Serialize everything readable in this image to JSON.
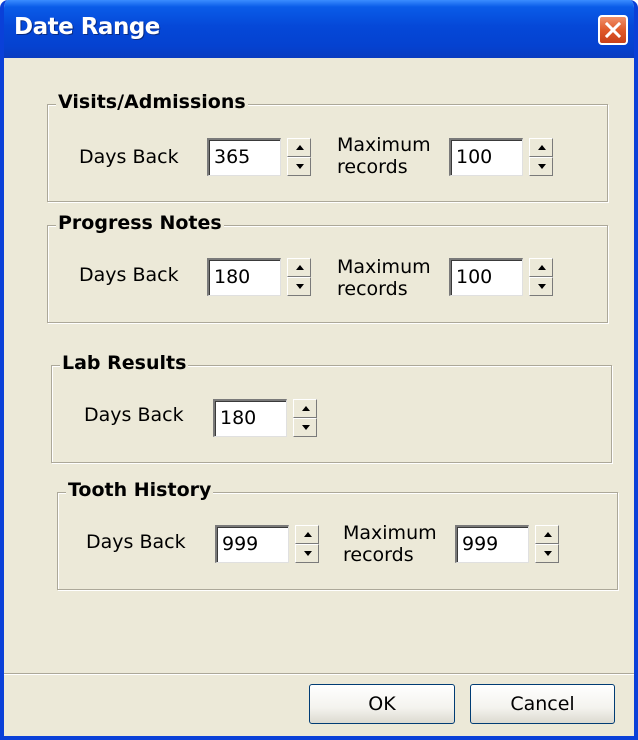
{
  "window": {
    "title": "Date Range"
  },
  "groups": {
    "visits": {
      "title": "Visits/Admissions",
      "days_label": "Days Back",
      "days_value": "365",
      "max_label_line1": "Maximum",
      "max_label_line2": "records",
      "max_value": "100"
    },
    "progress": {
      "title": "Progress Notes",
      "days_label": "Days Back",
      "days_value": "180",
      "max_label_line1": "Maximum",
      "max_label_line2": "records",
      "max_value": "100"
    },
    "lab": {
      "title": "Lab Results",
      "days_label": "Days Back",
      "days_value": "180"
    },
    "tooth": {
      "title": "Tooth History",
      "days_label": "Days Back",
      "days_value": "999",
      "max_label_line1": "Maximum",
      "max_label_line2": "records",
      "max_value": "999"
    }
  },
  "buttons": {
    "ok": "OK",
    "cancel": "Cancel"
  },
  "colors": {
    "titlebar": "#0548d8",
    "face": "#ece9d8",
    "close": "#e05a2a"
  },
  "icons": {
    "close": "close-icon",
    "spin_up": "arrow-up-icon",
    "spin_down": "arrow-down-icon"
  }
}
